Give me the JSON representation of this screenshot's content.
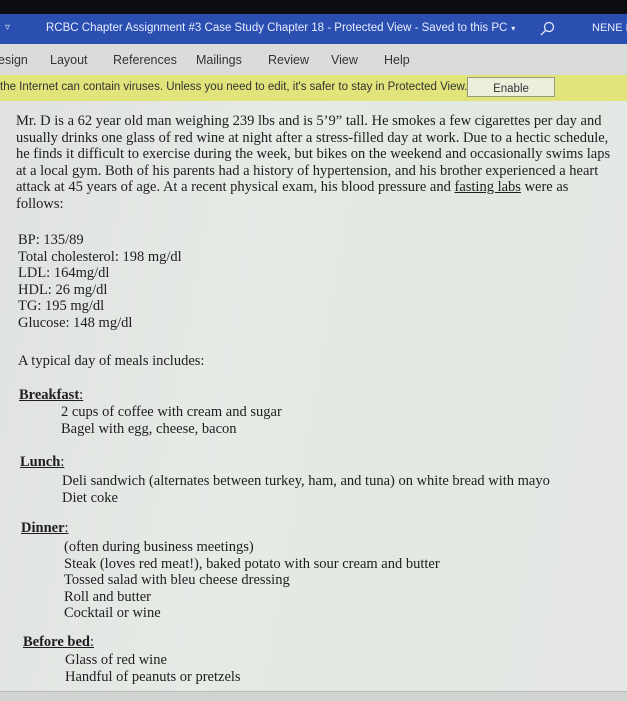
{
  "titlebar": {
    "qat_icon": "dropdown-arrow-icon",
    "title": "RCBC Chapter Assignment #3 Case Study Chapter 18  -  Protected View  -  Saved to this PC",
    "title_caret": "▾",
    "search_icon": "search-icon",
    "user": "NENE D"
  },
  "ribbon": {
    "tabs": [
      "esign",
      "Layout",
      "References",
      "Mailings",
      "Review",
      "View",
      "Help"
    ]
  },
  "protected_view": {
    "message": "the Internet can contain viruses. Unless you need to edit, it's safer to stay in Protected View.",
    "button": "Enable Editing"
  },
  "document": {
    "intro_before": "Mr. D is a 62 year old man weighing 239 lbs and is 5’9” tall. He smokes a few cigarettes per day and usually drinks one glass of red wine at night after a stress-filled day at work. Due to a hectic schedule, he finds it difficult to exercise during the week, but bikes on the weekend and occasionally swims laps at a local gym. Both of his parents had a history of hypertension, and his brother experienced a heart attack at 45 years of age. At a recent physical exam, his blood pressure and ",
    "intro_underlined": "fasting labs",
    "intro_after": " were as follows:",
    "labs": [
      "BP: 135/89",
      "Total cholesterol: 198 mg/dl",
      "LDL: 164mg/dl",
      "HDL: 26 mg/dl",
      "TG: 195 mg/dl",
      "Glucose: 148 mg/dl"
    ],
    "meals_intro": "A typical day of meals includes:",
    "meals": [
      {
        "label": "Breakfast",
        "items": [
          "2 cups of coffee with cream and sugar",
          "Bagel with egg, cheese, bacon"
        ]
      },
      {
        "label": "Lunch",
        "items": [
          "Deli sandwich (alternates between turkey, ham, and tuna) on white bread with mayo",
          "Diet coke"
        ]
      },
      {
        "label": "Dinner",
        "items": [
          "(often during business meetings)",
          "Steak (loves red meat!), baked potato with sour cream and butter",
          "Tossed salad with bleu cheese dressing",
          "Roll and butter",
          "Cocktail or wine"
        ]
      },
      {
        "label": "Before bed",
        "items": [
          "Glass of red wine",
          "Handful of peanuts or pretzels"
        ]
      }
    ],
    "colon": ":"
  }
}
